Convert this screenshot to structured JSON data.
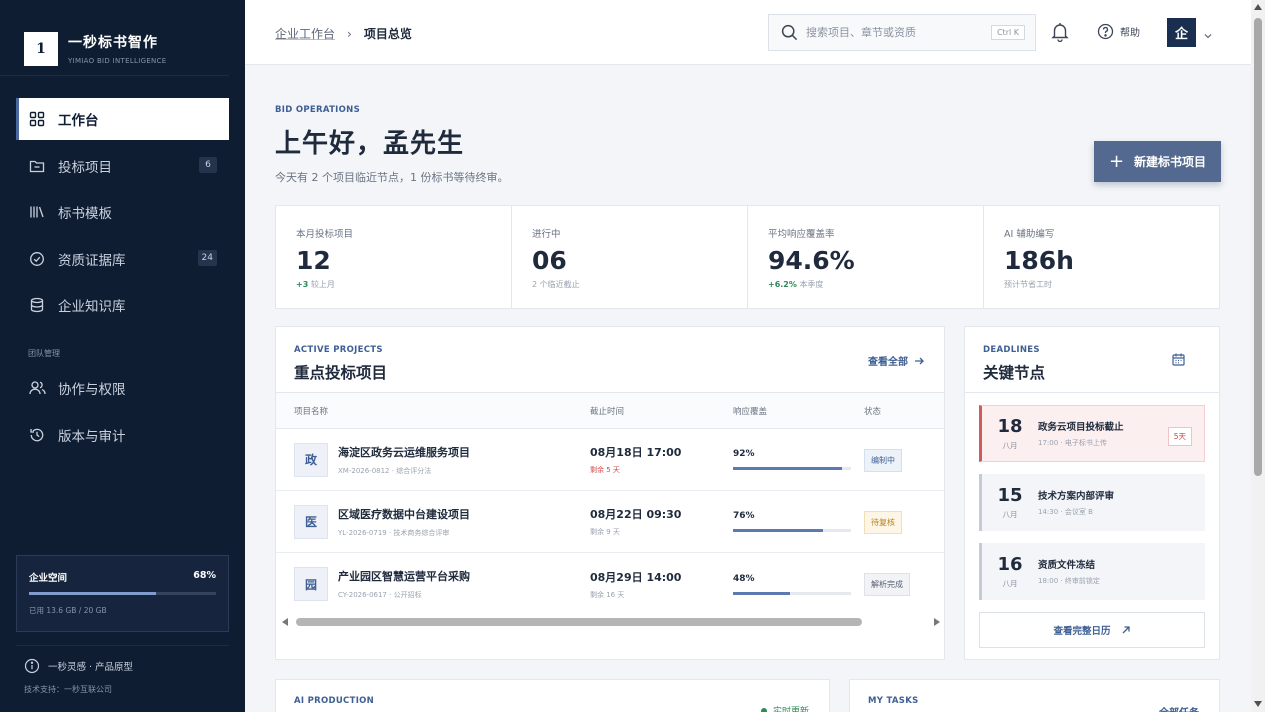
{
  "brand": {
    "logo": "1",
    "name": "一秒标书智作",
    "sub": "YIMIAO BID INTELLIGENCE"
  },
  "nav": {
    "items": [
      {
        "label": "工作台",
        "icon": "grid-icon",
        "active": true
      },
      {
        "label": "投标项目",
        "icon": "folder-icon",
        "count": "6"
      },
      {
        "label": "标书模板",
        "icon": "library-icon"
      },
      {
        "label": "资质证据库",
        "icon": "check-circle-icon",
        "count": "24"
      },
      {
        "label": "企业知识库",
        "icon": "database-icon"
      }
    ],
    "section_label": "团队管理",
    "team_items": [
      {
        "label": "协作与权限",
        "icon": "users-icon"
      },
      {
        "label": "版本与审计",
        "icon": "history-icon"
      }
    ]
  },
  "storage": {
    "label": "企业空间",
    "percent_text": "68%",
    "fraction": 0.68,
    "used": "已用 13.6 GB / 20 GB"
  },
  "footer": {
    "product": "一秒灵感 · 产品原型",
    "support": "技术支持：一秒互联公司"
  },
  "header": {
    "breadcrumb_parent": "企业工作台",
    "breadcrumb_sep": "›",
    "breadcrumb_current": "项目总览",
    "search_placeholder": "搜索项目、章节或资质",
    "search_kbd": "Ctrl K",
    "help_label": "帮助",
    "avatar": "企"
  },
  "hero": {
    "eyebrow": "BID OPERATIONS",
    "greeting": "上午好，孟先生",
    "subtitle": "今天有 2 个项目临近节点，1 份标书等待终审。",
    "new_button": "新建标书项目"
  },
  "stats": [
    {
      "label": "本月投标项目",
      "value": "12",
      "up": "+3",
      "note": "较上月"
    },
    {
      "label": "进行中",
      "value": "06",
      "up": "",
      "note": "2 个临近截止"
    },
    {
      "label": "平均响应覆盖率",
      "value": "94.6%",
      "up": "+6.2%",
      "note": "本季度"
    },
    {
      "label": "AI 辅助编写",
      "value": "186h",
      "up": "",
      "note": "预计节省工时"
    }
  ],
  "projects": {
    "eyebrow": "ACTIVE PROJECTS",
    "title": "重点投标项目",
    "view_all": "查看全部",
    "columns": [
      "项目名称",
      "截止时间",
      "响应覆盖",
      "状态"
    ],
    "rows": [
      {
        "badge": "政",
        "name": "海淀区政务云运维服务项目",
        "meta": "XM-2026-0812 · 综合评分法",
        "deadline": "08月18日 17:00",
        "left": "剩余 5 天",
        "left_urgent": true,
        "coverage_text": "92%",
        "coverage": 0.92,
        "status": "编制中",
        "status_style": "blue"
      },
      {
        "badge": "医",
        "name": "区域医疗数据中台建设项目",
        "meta": "YL-2026-0719 · 技术商务综合评审",
        "deadline": "08月22日 09:30",
        "left": "剩余 9 天",
        "left_urgent": false,
        "coverage_text": "76%",
        "coverage": 0.76,
        "status": "待复核",
        "status_style": "amber"
      },
      {
        "badge": "园",
        "name": "产业园区智慧运营平台采购",
        "meta": "CY-2026-0617 · 公开招标",
        "deadline": "08月29日 14:00",
        "left": "剩余 16 天",
        "left_urgent": false,
        "coverage_text": "48%",
        "coverage": 0.48,
        "status": "解析完成",
        "status_style": "gray"
      }
    ]
  },
  "deadlines": {
    "eyebrow": "DEADLINES",
    "title": "关键节点",
    "items": [
      {
        "day": "18",
        "month": "八月",
        "title": "政务云项目投标截止",
        "sub": "17:00 · 电子标书上传",
        "tag": "5天",
        "urgent": true
      },
      {
        "day": "15",
        "month": "八月",
        "title": "技术方案内部评审",
        "sub": "14:30 · 会议室 B",
        "tag": "",
        "urgent": false
      },
      {
        "day": "16",
        "month": "八月",
        "title": "资质文件冻结",
        "sub": "18:00 · 终审前锁定",
        "tag": "",
        "urgent": false
      }
    ],
    "more": "查看完整日历"
  },
  "lower": {
    "ai_eyebrow": "AI PRODUCTION",
    "ai_status": "实时更新",
    "tasks_eyebrow": "MY TASKS",
    "tasks_link": "全部任务"
  }
}
